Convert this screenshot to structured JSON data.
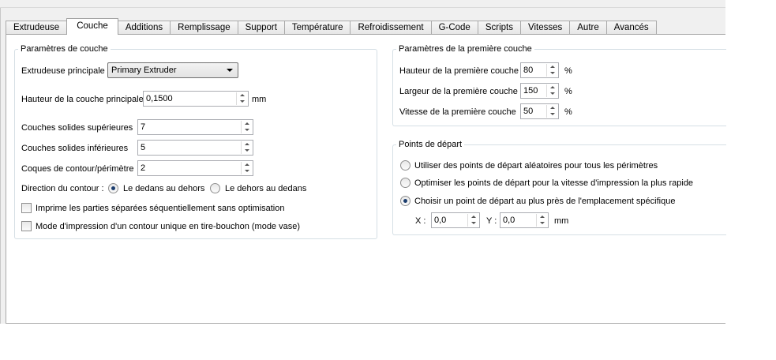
{
  "tabs": [
    "Extrudeuse",
    "Couche",
    "Additions",
    "Remplissage",
    "Support",
    "Température",
    "Refroidissement",
    "G-Code",
    "Scripts",
    "Vitesses",
    "Autre",
    "Avancés"
  ],
  "active_tab": "Couche",
  "layer_params": {
    "legend": "Paramètres de couche",
    "main_extruder_label": "Extrudeuse principale",
    "main_extruder_value": "Primary Extruder",
    "layer_height_label": "Hauteur de la couche principale",
    "layer_height_value": "0,1500",
    "layer_height_unit": "mm",
    "top_solid_label": "Couches solides supérieures",
    "top_solid_value": "7",
    "bottom_solid_label": "Couches solides inférieures",
    "bottom_solid_value": "5",
    "shells_label": "Coques de contour/périmètre",
    "shells_value": "2",
    "direction_label": "Direction du contour :",
    "direction_inside_out": "Le dedans au dehors",
    "direction_outside_in": "Le dehors au dedans",
    "sequential_label": "Imprime les parties séparées séquentiellement sans optimisation",
    "vase_label": "Mode d'impression d'un contour unique en tire-bouchon (mode vase)"
  },
  "first_layer": {
    "legend": "Paramètres de la première couche",
    "height_label": "Hauteur de la première couche",
    "height_value": "80",
    "width_label": "Largeur de la première couche",
    "width_value": "150",
    "speed_label": "Vitesse de la première couche",
    "speed_value": "50",
    "percent": "%"
  },
  "start_points": {
    "legend": "Points de départ",
    "option_random": "Utiliser des points de départ aléatoires pour tous les périmètres",
    "option_optimize": "Optimiser les points de départ pour la vitesse d'impression la plus rapide",
    "option_nearest": "Choisir un point de départ au plus près de l'emplacement spécifique",
    "x_label": "X :",
    "x_value": "0,0",
    "y_label": "Y :",
    "y_value": "0,0",
    "unit": "mm"
  }
}
